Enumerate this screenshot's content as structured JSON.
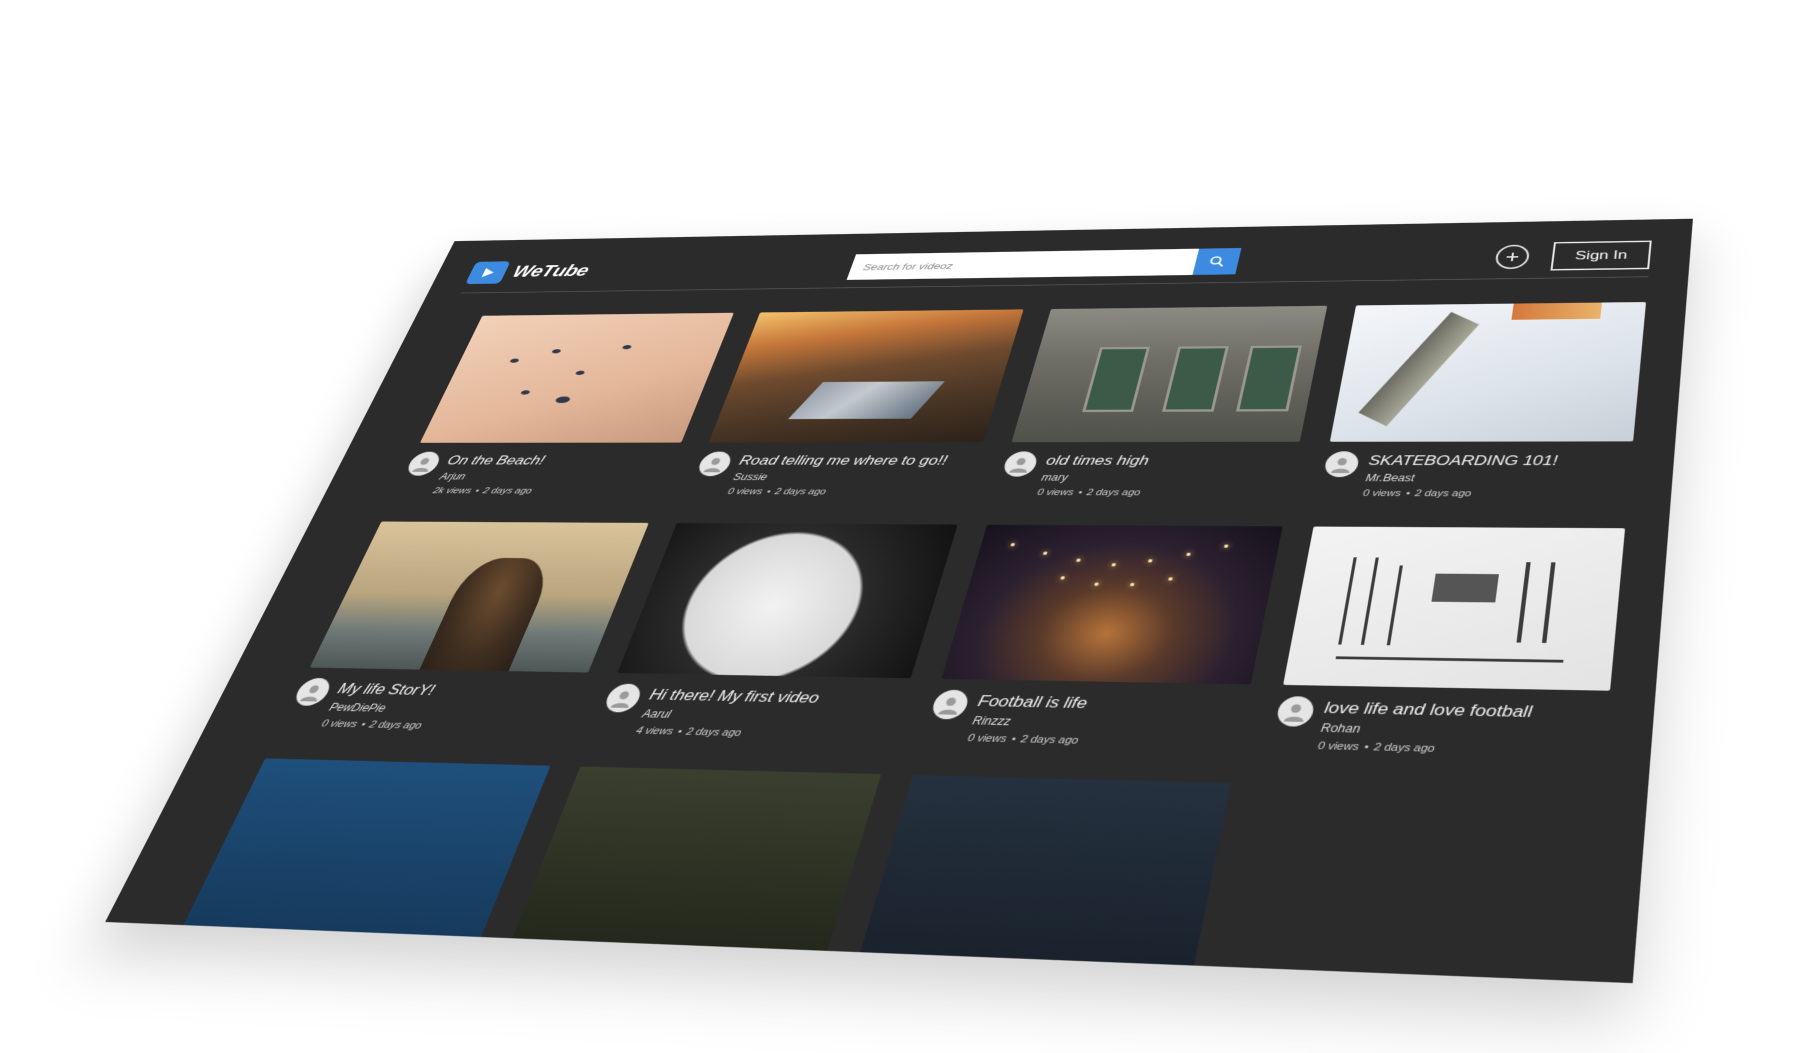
{
  "app": {
    "name": "WeTube",
    "accent_color": "#3d8be0",
    "background_color": "#2b2b2b"
  },
  "header": {
    "logo_icon": "play-icon",
    "search": {
      "placeholder": "Search for videoz",
      "button_icon": "search-icon"
    },
    "add_icon": "plus-icon",
    "signin_label": "Sign In"
  },
  "videos": [
    {
      "title": "On the Beach!",
      "channel": "Arjun",
      "views": "2k views",
      "dot": "•",
      "age": "2 days ago",
      "thumb": "beach"
    },
    {
      "title": "Road telling me where to go!!",
      "channel": "Sussie",
      "views": "0 views",
      "dot": "•",
      "age": "2 days ago",
      "thumb": "road"
    },
    {
      "title": "old times high",
      "channel": "mary",
      "views": "0 views",
      "dot": "•",
      "age": "2 days ago",
      "thumb": "old-building"
    },
    {
      "title": "SKATEBOARDING 101!",
      "channel": "Mr.Beast",
      "views": "0 views",
      "dot": "•",
      "age": "2 days ago",
      "thumb": "skate"
    },
    {
      "title": "My life StorY!",
      "channel": "PewDiePie",
      "views": "0 views",
      "dot": "•",
      "age": "2 days ago",
      "thumb": "person-sea"
    },
    {
      "title": "Hi there! My first video",
      "channel": "Aarul",
      "views": "4 views",
      "dot": "•",
      "age": "2 days ago",
      "thumb": "clock"
    },
    {
      "title": "Football is life",
      "channel": "Rinzzz",
      "views": "0 views",
      "dot": "•",
      "age": "2 days ago",
      "thumb": "street-lights"
    },
    {
      "title": "love life and love football",
      "channel": "Rohan",
      "views": "0 views",
      "dot": "•",
      "age": "2 days ago",
      "thumb": "tools"
    }
  ]
}
